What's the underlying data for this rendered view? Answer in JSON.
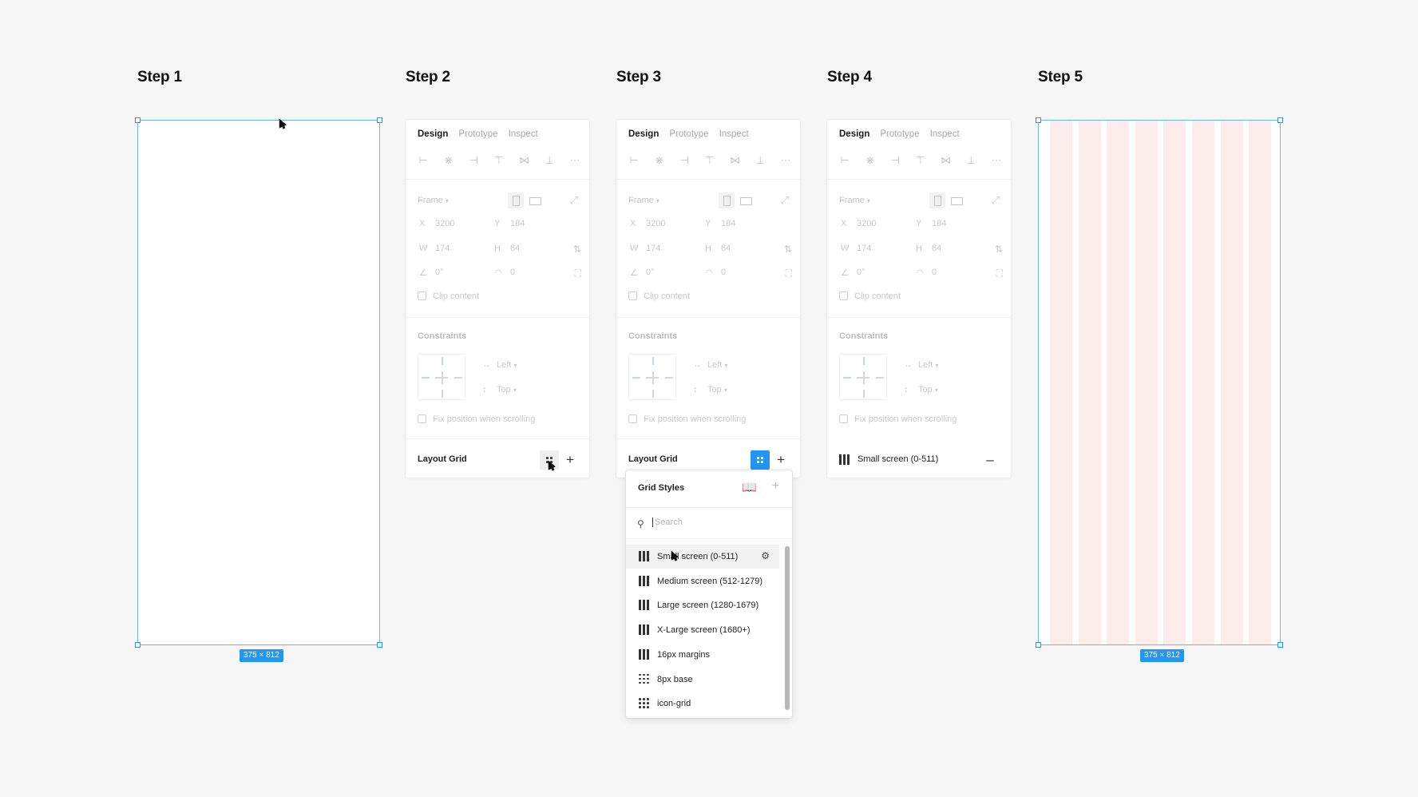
{
  "steps": [
    {
      "title": "Step 1"
    },
    {
      "title": "Step 2"
    },
    {
      "title": "Step 3"
    },
    {
      "title": "Step 4"
    },
    {
      "title": "Step 5"
    }
  ],
  "frame": {
    "dimensions": "375 × 812"
  },
  "panel": {
    "tabs": [
      "Design",
      "Prototype",
      "Inspect"
    ],
    "frame_label": "Frame",
    "x_label": "X",
    "x_value": "3200",
    "y_label": "Y",
    "y_value": "184",
    "w_label": "W",
    "w_value": "174",
    "h_label": "H",
    "h_value": "64",
    "rotation_value": "0°",
    "radius_value": "0",
    "clip_content": "Clip content",
    "constraints_title": "Constraints",
    "constraint_h": "Left",
    "constraint_v": "Top",
    "fix_position": "Fix position when scrolling",
    "layout_grid": "Layout Grid",
    "applied_grid": "Small screen (0-511)"
  },
  "grid_styles": {
    "title": "Grid Styles",
    "search_placeholder": "Search",
    "items": [
      {
        "label": "Small screen (0-511)",
        "icon": "columns-icon"
      },
      {
        "label": "Medium screen (512-1279)",
        "icon": "columns-icon"
      },
      {
        "label": "Large screen (1280-1679)",
        "icon": "columns-icon"
      },
      {
        "label": "X-Large screen (1680+)",
        "icon": "columns-icon"
      },
      {
        "label": "16px margins",
        "icon": "columns-icon"
      },
      {
        "label": "8px base",
        "icon": "grid-icon"
      },
      {
        "label": "icon-grid",
        "icon": "grid-icon"
      }
    ]
  },
  "colors": {
    "accent": "#2196f3",
    "selection_border": "#6ab4f2",
    "grid_column": "#fdecec"
  }
}
